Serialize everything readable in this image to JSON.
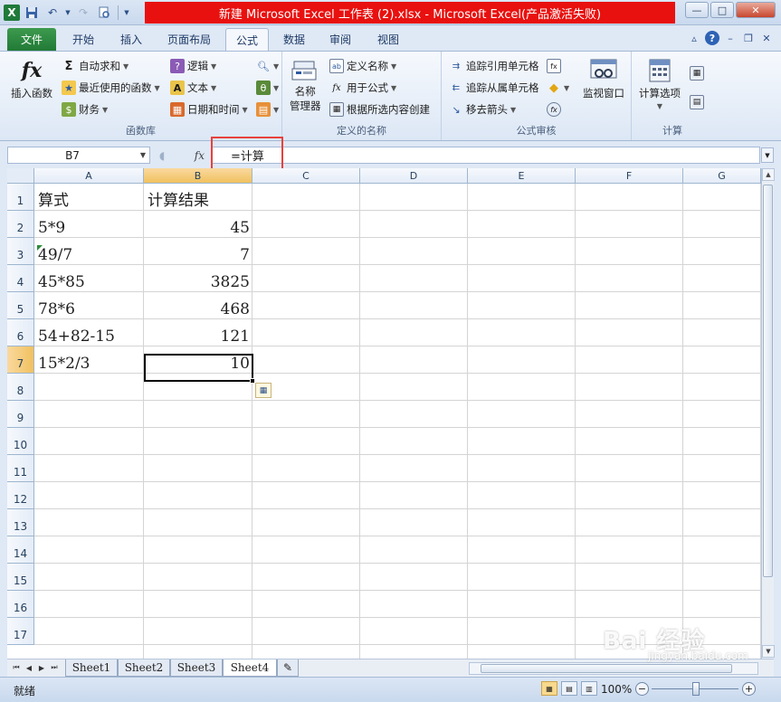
{
  "window": {
    "title": "新建 Microsoft Excel 工作表 (2).xlsx  -  Microsoft Excel(产品激活失败)",
    "controls": {
      "minimize": "—",
      "restore": "□",
      "close": "✕"
    }
  },
  "quick_access": [
    "excel-logo",
    "save-icon",
    "undo-icon",
    "redo-icon",
    "print-preview-icon",
    "customize-icon"
  ],
  "tabs": [
    {
      "label": "文件",
      "active": false,
      "file": true
    },
    {
      "label": "开始",
      "active": false
    },
    {
      "label": "插入",
      "active": false
    },
    {
      "label": "页面布局",
      "active": false
    },
    {
      "label": "公式",
      "active": true
    },
    {
      "label": "数据",
      "active": false
    },
    {
      "label": "审阅",
      "active": false
    },
    {
      "label": "视图",
      "active": false
    }
  ],
  "ribbon": {
    "function_library": {
      "label": "函数库",
      "insert_function": "插入函数",
      "autosum": "自动求和",
      "recent": "最近使用的函数",
      "financial": "财务",
      "logical": "逻辑",
      "text": "文本",
      "datetime": "日期和时间"
    },
    "defined_names": {
      "label": "定义的名称",
      "name_manager_1": "名称",
      "name_manager_2": "管理器",
      "define_name": "定义名称",
      "use_in_formula": "用于公式",
      "create_from_selection": "根据所选内容创建"
    },
    "formula_auditing": {
      "label": "公式审核",
      "trace_precedents": "追踪引用单元格",
      "trace_dependents": "追踪从属单元格",
      "remove_arrows": "移去箭头",
      "watch_window": "监视窗口"
    },
    "calculation": {
      "label": "计算",
      "calc_options": "计算选项"
    }
  },
  "formula_bar": {
    "name_box": "B7",
    "fx": "fx",
    "formula": "=计算"
  },
  "grid": {
    "columns": [
      "A",
      "B",
      "C",
      "D",
      "E",
      "F",
      "G"
    ],
    "rows": [
      "1",
      "2",
      "3",
      "4",
      "5",
      "6",
      "7",
      "8",
      "9",
      "10",
      "11",
      "12",
      "13",
      "14",
      "15",
      "16",
      "17"
    ],
    "selected_cell": "B7",
    "cells": [
      {
        "row": 1,
        "a": "算式",
        "b": "计算结果"
      },
      {
        "row": 2,
        "a": "5*9",
        "b": "45"
      },
      {
        "row": 3,
        "a": "49/7",
        "b": "7"
      },
      {
        "row": 4,
        "a": "45*85",
        "b": "3825"
      },
      {
        "row": 5,
        "a": "78*6",
        "b": "468"
      },
      {
        "row": 6,
        "a": "54+82-15",
        "b": "121"
      },
      {
        "row": 7,
        "a": "15*2/3",
        "b": "10"
      }
    ]
  },
  "sheets": [
    {
      "label": "Sheet1",
      "active": false
    },
    {
      "label": "Sheet2",
      "active": false
    },
    {
      "label": "Sheet3",
      "active": false
    },
    {
      "label": "Sheet4",
      "active": true
    }
  ],
  "status": {
    "text": "就绪",
    "zoom": "100%",
    "zoom_minus": "−",
    "zoom_plus": "+"
  },
  "watermark": {
    "brand": "Bai 经验",
    "url": "jingyan.baidu.com"
  },
  "colors": {
    "title_highlight": "#e8110f",
    "file_tab": "#217a36",
    "selection_header": "#f1c15f",
    "annotation_box": "#e8413c"
  }
}
